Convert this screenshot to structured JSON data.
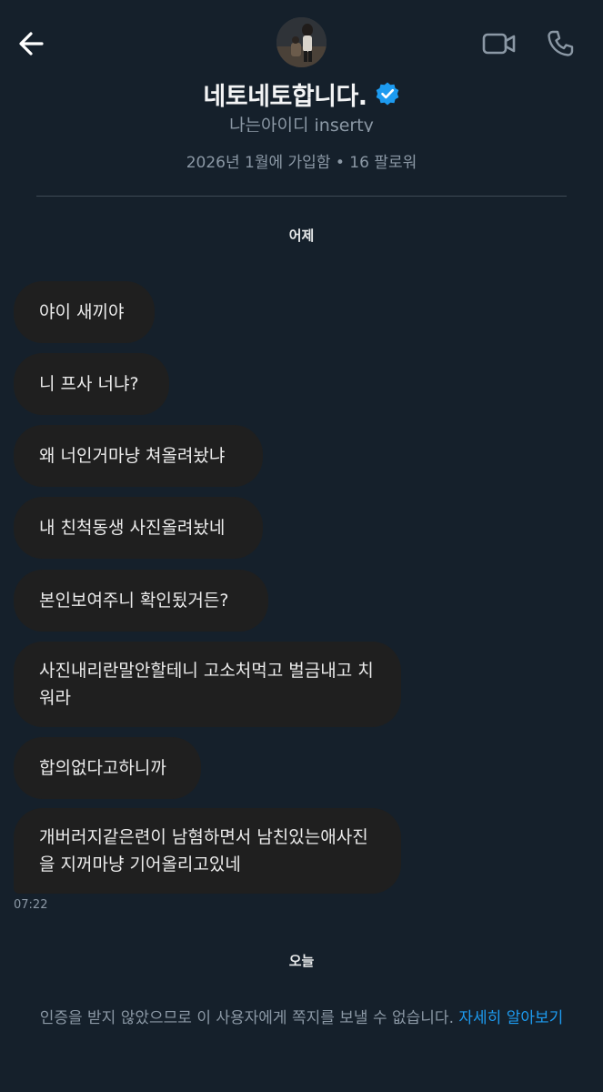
{
  "header": {
    "back_icon": "arrow-left-icon",
    "video_icon": "video-camera-icon",
    "call_icon": "phone-icon"
  },
  "profile": {
    "name": "네토네토합니다.",
    "verified_icon": "verified-badge-icon",
    "verified_color": "#1d9bf0",
    "handle": "나는아이디 insertу",
    "meta": "2026년 1월에 가입함 • 16 팔로워"
  },
  "conversation": {
    "yesterday_label": "어제",
    "messages": [
      {
        "text": "야이 새끼야"
      },
      {
        "text": "니 프사 너냐?"
      },
      {
        "text": "왜 너인거마냥 쳐올려놨냐"
      },
      {
        "text": "내 친척동생 사진올려놨네"
      },
      {
        "text": "본인보여주니 확인됬거든?"
      },
      {
        "text": "사진내리란말안할테니 고소처먹고 벌금내고 치워라"
      },
      {
        "text": "합의없다고하니까"
      },
      {
        "text": "개버러지같은련이 남혐하면서 남친있는애사진을 지꺼마냥 기어올리고있네"
      }
    ],
    "last_timestamp": "07:22",
    "today_label": "오늘"
  },
  "notice": {
    "text": "인증을 받지 않았으므로 이 사용자에게 쪽지를 보낼 수 없습니다.",
    "link": "자세히 알아보기"
  },
  "colors": {
    "background": "#15202b",
    "bubble": "#1f1f1f",
    "link": "#1d9bf0",
    "secondary_text": "#8b98a5"
  }
}
